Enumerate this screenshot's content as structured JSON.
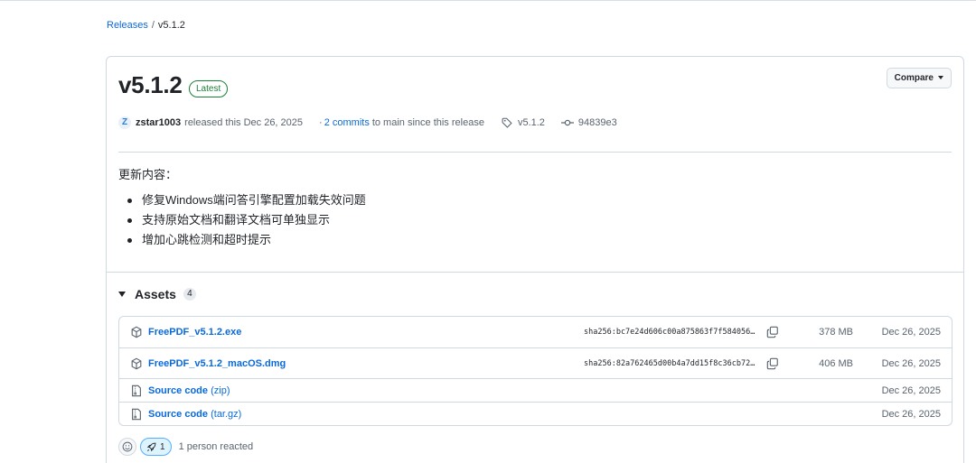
{
  "breadcrumb": {
    "root": "Releases",
    "separator": "/",
    "current": "v5.1.2"
  },
  "release": {
    "title": "v5.1.2",
    "badge": "Latest",
    "compare_label": "Compare",
    "author": "zstar1003",
    "avatar_letter": "Z",
    "released_text": "released this Dec 26, 2025",
    "commits_prefix": "·",
    "commits_link": "2 commits",
    "commits_rest": "to main since this release",
    "tag": "v5.1.2",
    "commit_hash": "94839e3"
  },
  "notes": {
    "heading": "更新内容：",
    "items": [
      "修复Windows端问答引擎配置加载失效问题",
      "支持原始文档和翻译文档可单独显示",
      "增加心跳检测和超时提示"
    ]
  },
  "assets": {
    "label": "Assets",
    "count": "4",
    "rows": [
      {
        "name": "FreePDF_v5.1.2.exe",
        "sha": "sha256:bc7e24d606c00a875863f7f584056…",
        "size": "378 MB",
        "date": "Dec 26, 2025"
      },
      {
        "name": "FreePDF_v5.1.2_macOS.dmg",
        "sha": "sha256:82a762465d00b4a7dd15f8c36cb72…",
        "size": "406 MB",
        "date": "Dec 26, 2025"
      },
      {
        "name": "Source code",
        "ext": "(zip)",
        "date": "Dec 26, 2025"
      },
      {
        "name": "Source code",
        "ext": "(tar.gz)",
        "date": "Dec 26, 2025"
      }
    ]
  },
  "reactions": {
    "rocket_count": "1",
    "summary": "1 person reacted"
  },
  "colors": {
    "link": "#0969da",
    "latest": "#1a7f37",
    "border": "#d1d9e0",
    "muted": "#59636e"
  }
}
